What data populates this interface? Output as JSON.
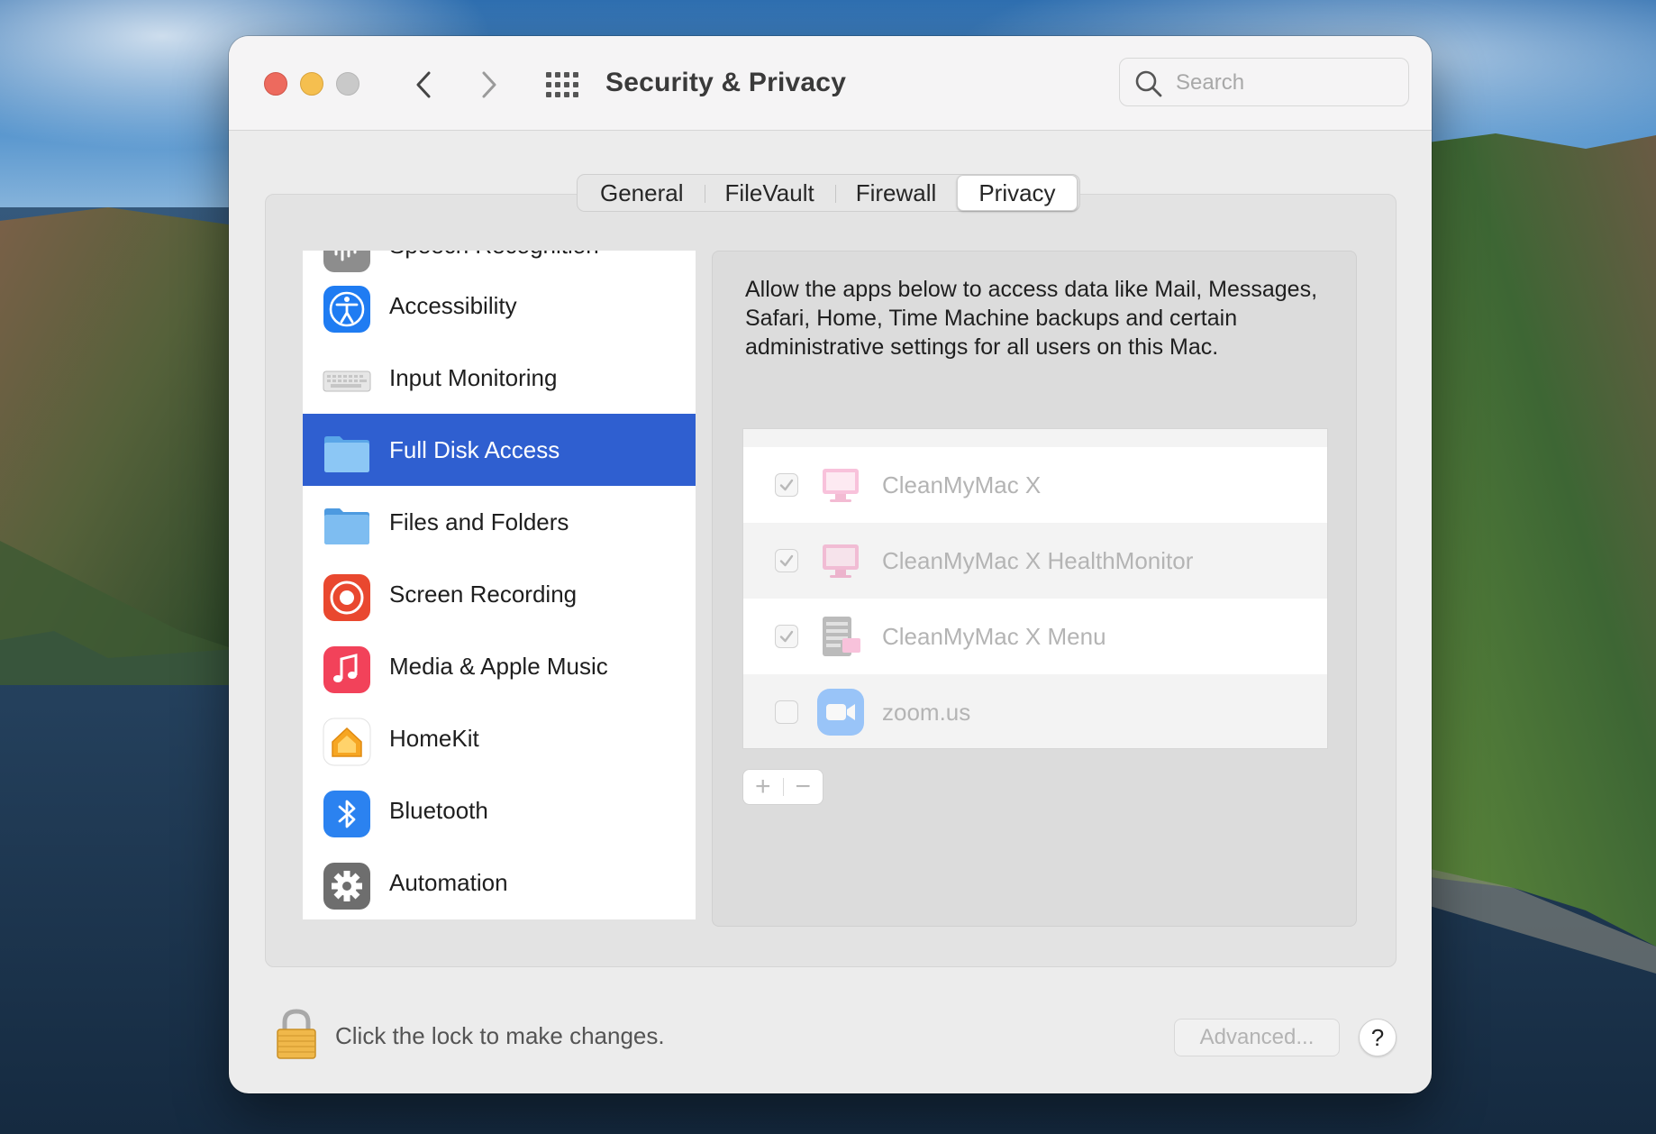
{
  "window": {
    "title": "Security & Privacy"
  },
  "search": {
    "placeholder": "Search"
  },
  "tabs": [
    {
      "label": "General",
      "active": false
    },
    {
      "label": "FileVault",
      "active": false
    },
    {
      "label": "Firewall",
      "active": false
    },
    {
      "label": "Privacy",
      "active": true
    }
  ],
  "sidebar": {
    "items": [
      {
        "label": "Speech Recognition",
        "icon": "speech-recognition-icon",
        "partial": true
      },
      {
        "label": "Accessibility",
        "icon": "accessibility-icon"
      },
      {
        "label": "Input Monitoring",
        "icon": "keyboard-icon"
      },
      {
        "label": "Full Disk Access",
        "icon": "folder-icon",
        "selected": true
      },
      {
        "label": "Files and Folders",
        "icon": "folder-icon"
      },
      {
        "label": "Screen Recording",
        "icon": "screen-recording-icon"
      },
      {
        "label": "Media & Apple Music",
        "icon": "music-icon"
      },
      {
        "label": "HomeKit",
        "icon": "home-icon"
      },
      {
        "label": "Bluetooth",
        "icon": "bluetooth-icon"
      },
      {
        "label": "Automation",
        "icon": "gear-icon"
      }
    ]
  },
  "detail": {
    "description": "Allow the apps below to access data like Mail, Messages, Safari, Home, Time Machine backups and certain administrative settings for all users on this Mac.",
    "apps": [
      {
        "name": "CleanMyMac X",
        "checked": true,
        "icon": "cleanmymac-icon"
      },
      {
        "name": "CleanMyMac X HealthMonitor",
        "checked": true,
        "icon": "cleanmymac-icon"
      },
      {
        "name": "CleanMyMac X Menu",
        "checked": true,
        "icon": "cleanmymac-menu-icon"
      },
      {
        "name": "zoom.us",
        "checked": false,
        "icon": "zoom-icon"
      }
    ],
    "add_label": "+",
    "remove_label": "−"
  },
  "footer": {
    "lock_text": "Click the lock to make changes.",
    "advanced_label": "Advanced...",
    "help_label": "?"
  },
  "colors": {
    "selection": "#2f5fd0",
    "close": "#ed6a5e",
    "minimize": "#f5bf4f",
    "zoom": "#c9c9c9"
  }
}
